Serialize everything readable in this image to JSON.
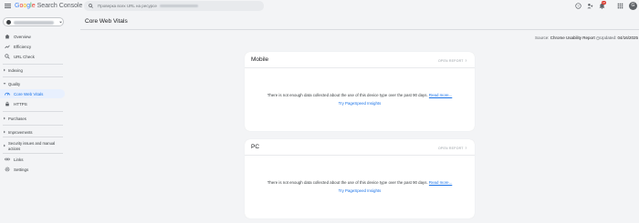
{
  "app": {
    "name_parts": [
      "G",
      "o",
      "o",
      "g",
      "l",
      "e"
    ],
    "product": "Search Console"
  },
  "search": {
    "placeholder": "Проверка всех URL на ресурсе"
  },
  "notifications": {
    "count": "47"
  },
  "user": {
    "avatar_letter": "G"
  },
  "property": {
    "name": ""
  },
  "page": {
    "title": "Core Web Vitals"
  },
  "sidebar": {
    "items": [
      {
        "label": "Overview",
        "icon": "home-icon"
      },
      {
        "label": "Efficiency",
        "icon": "trending-icon"
      },
      {
        "label": "URL Check",
        "icon": "search-icon"
      }
    ],
    "sections": [
      {
        "label": "Indexing"
      },
      {
        "label": "Quality"
      },
      {
        "label": "Purchases"
      },
      {
        "label": "Improvements"
      }
    ],
    "quality_items": [
      {
        "label": "Core Web Vitals",
        "icon": "speed-icon"
      },
      {
        "label": "HTTPS",
        "icon": "lock-icon"
      }
    ],
    "security_label_1": "Security issues and manual",
    "security_label_2": "actions",
    "bottom_items": [
      {
        "label": "Links",
        "icon": "link-icon"
      },
      {
        "label": "Settings",
        "icon": "gear-icon"
      }
    ]
  },
  "meta": {
    "source_label": "Source:",
    "source_value": "Chrome Usability Report",
    "updated_label": "Updated:",
    "updated_value": "04/16/2025"
  },
  "cards": [
    {
      "title": "Mobile",
      "open_report": "OPEN REPORT",
      "message": "There is not enough data collected about the use of this device type over the past 90 days.",
      "read_more": "Read more...",
      "link": "Try PageSpeed Insights"
    },
    {
      "title": "PC",
      "open_report": "OPEN REPORT",
      "message": "There is not enough data collected about the use of this device type over the past 90 days.",
      "read_more": "Read more...",
      "link": "Try PageSpeed Insights"
    }
  ],
  "colors": {
    "accent": "#1a73e8",
    "background": "#f3f4f6",
    "active_nav_bg": "#e8f0fe"
  }
}
